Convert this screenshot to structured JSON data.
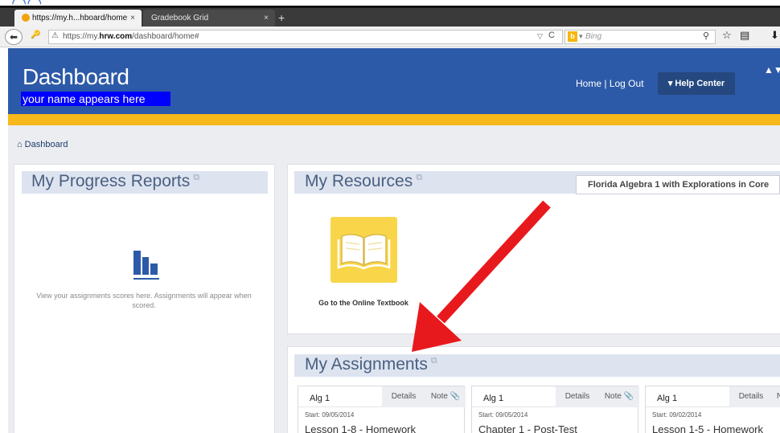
{
  "browser": {
    "tabs": [
      {
        "label": "https://my.h...hboard/home",
        "active": true
      },
      {
        "label": "Gradebook Grid",
        "active": false
      }
    ],
    "url_prefix": "https://my.",
    "url_domain": "hrw.com",
    "url_path": "/dashboard/home#",
    "search_placeholder": "Bing",
    "icons": [
      "back-arrow-icon",
      "key-icon",
      "warning-icon",
      "reload-icon",
      "bing-icon",
      "search-icon",
      "star-icon",
      "clipboard-icon",
      "download-icon"
    ]
  },
  "header": {
    "title": "Dashboard",
    "user_name": "your name appears here",
    "home_link": "Home",
    "separator": "|",
    "logout_link": "Log Out",
    "help_button": "Help Center",
    "help_caret": "▾"
  },
  "breadcrumb": {
    "label": "Dashboard"
  },
  "progress_reports": {
    "title": "My Progress Reports",
    "message": "View your assignments scores here. Assignments will appear when scored."
  },
  "resources": {
    "title": "My Resources",
    "course_selector": "Florida Algebra 1 with Explorations in Core",
    "textbook_label": "Go to the Online Textbook"
  },
  "assignments": {
    "title": "My Assignments",
    "items": [
      {
        "course": "Alg 1",
        "details": "Details",
        "note": "Note",
        "start": "Start: 09/05/2014",
        "title": "Lesson 1-8 - Homework"
      },
      {
        "course": "Alg 1",
        "details": "Details",
        "note": "Note",
        "start": "Start: 09/05/2014",
        "title": "Chapter 1 - Post-Test"
      },
      {
        "course": "Alg 1",
        "details": "Details",
        "note": "N",
        "start": "Start: 09/02/2014",
        "title": "Lesson 1-5 - Homework"
      }
    ]
  },
  "colors": {
    "header_blue": "#2d5aa8",
    "gold_stripe": "#f7b81c",
    "panel_header": "#dde4f0",
    "annotation_arrow": "#e8191c"
  }
}
